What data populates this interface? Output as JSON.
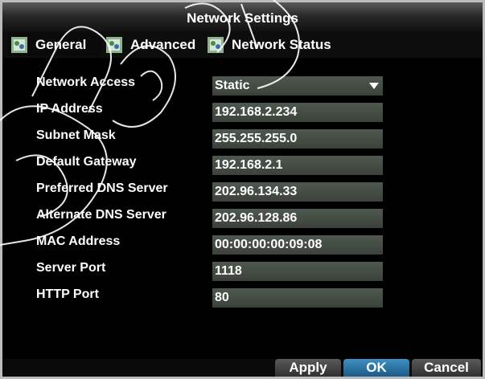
{
  "window": {
    "title": "Network Settings"
  },
  "tabs": [
    {
      "label": "General",
      "icon": "network-tab-icon"
    },
    {
      "label": "Advanced",
      "icon": "network-tab-icon"
    },
    {
      "label": "Network Status",
      "icon": "network-tab-icon"
    }
  ],
  "form": {
    "network_access": {
      "label": "Network Access",
      "value": "Static"
    },
    "ip_address": {
      "label": "IP Address",
      "value": "192.168.2.234"
    },
    "subnet_mask": {
      "label": "Subnet Mask",
      "value": "255.255.255.0"
    },
    "default_gateway": {
      "label": "Default Gateway",
      "value": "192.168.2.1"
    },
    "preferred_dns": {
      "label": "Preferred DNS Server",
      "value": "202.96.134.33"
    },
    "alternate_dns": {
      "label": "Alternate DNS Server",
      "value": "202.96.128.86"
    },
    "mac_address": {
      "label": "MAC Address",
      "value": "00:00:00:00:09:08"
    },
    "server_port": {
      "label": "Server Port",
      "value": "1118"
    },
    "http_port": {
      "label": "HTTP Port",
      "value": "80"
    }
  },
  "buttons": {
    "apply": "Apply",
    "ok": "OK",
    "cancel": "Cancel"
  },
  "colors": {
    "ok_button": "#2b73a8",
    "field_bg": "#464e46",
    "title_bg": "#3a3a3a"
  }
}
